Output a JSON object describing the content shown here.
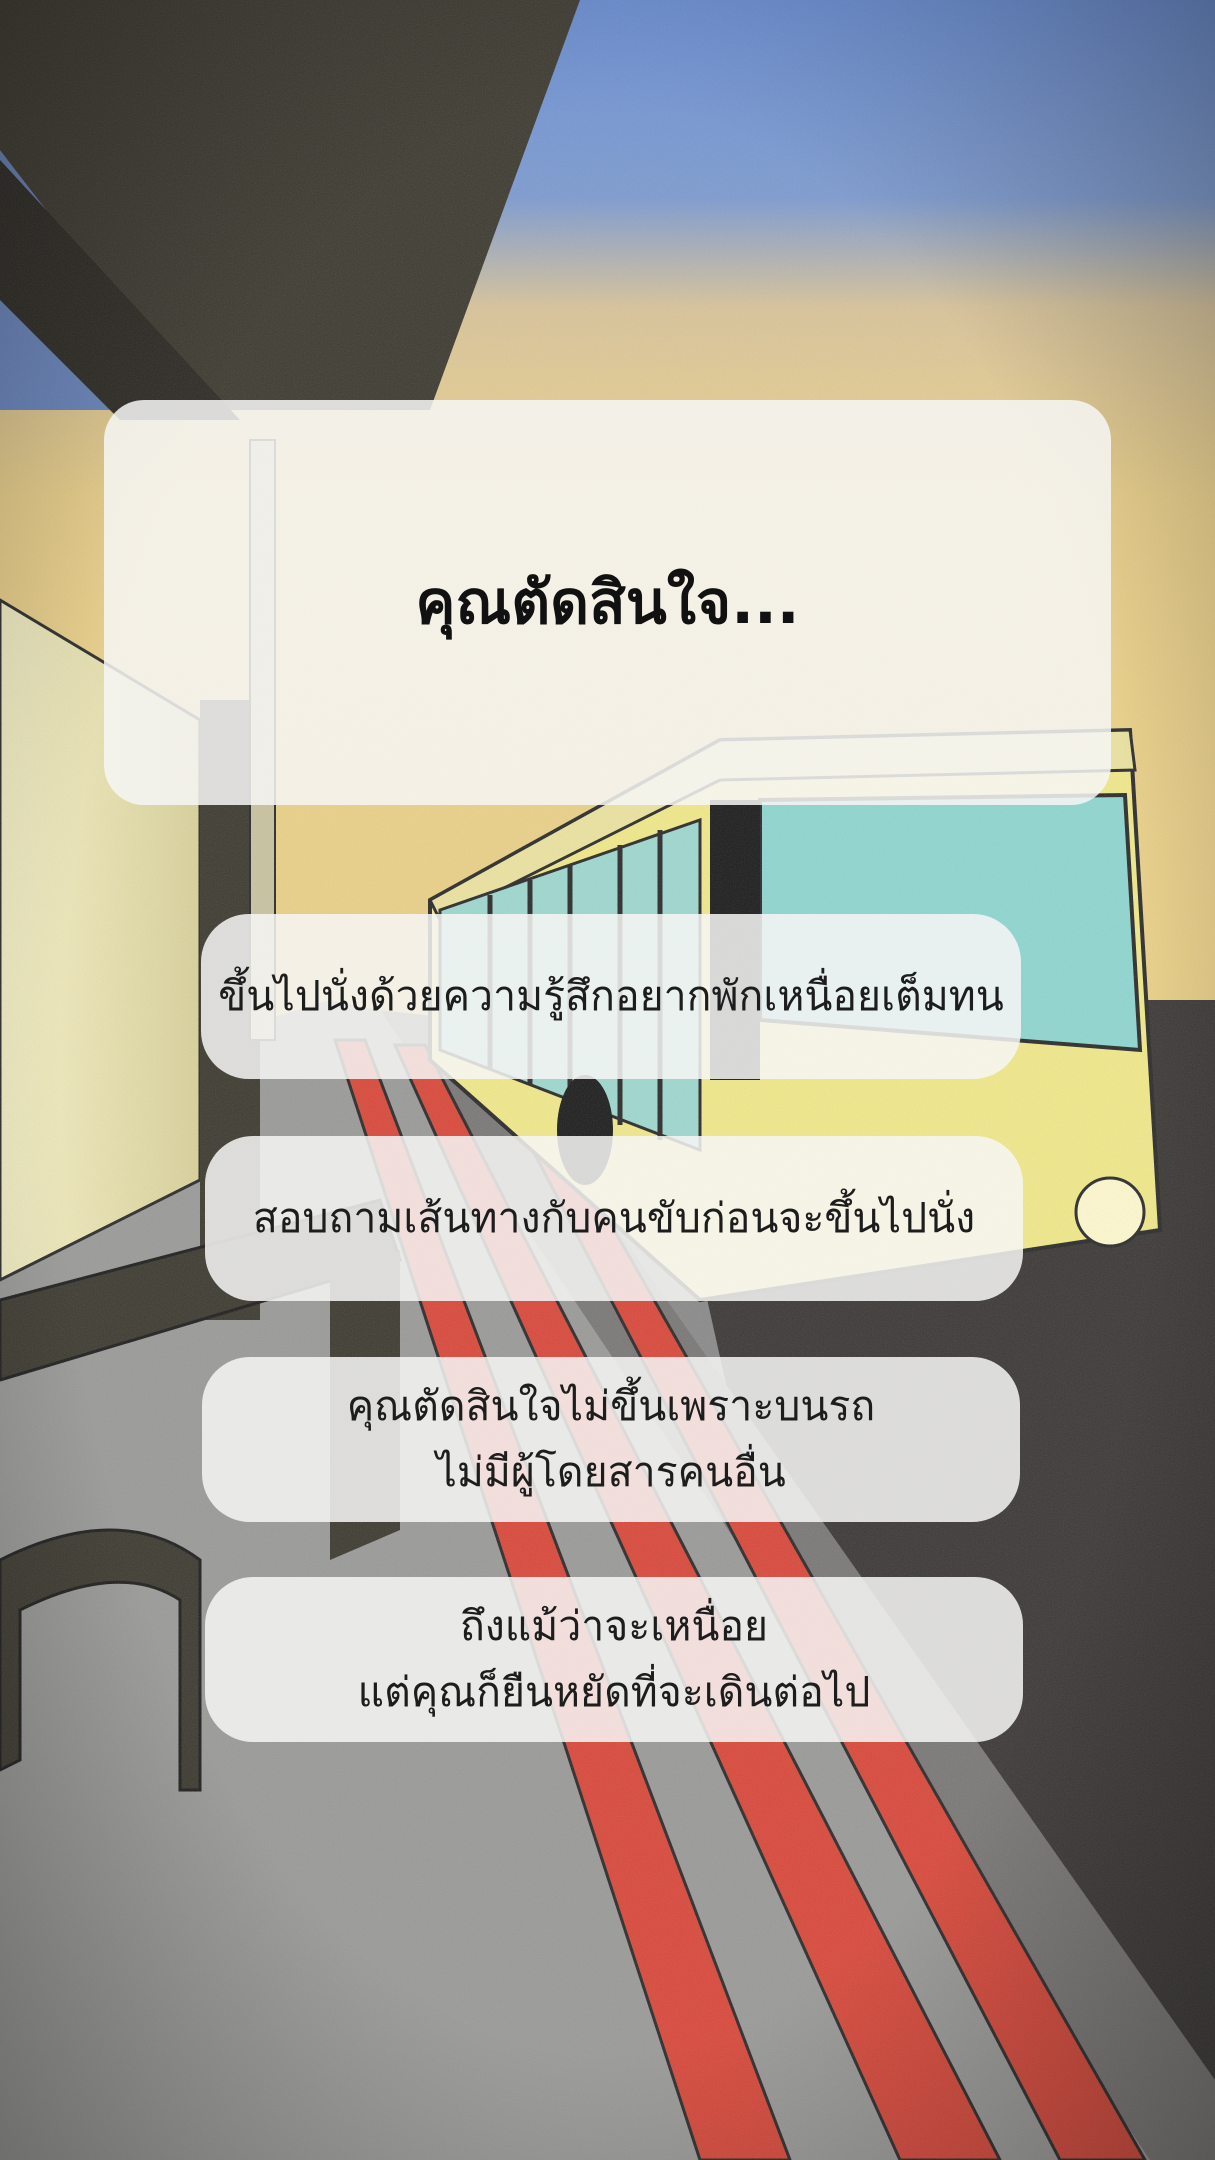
{
  "question": "คุณตัดสินใจ...",
  "choices": [
    {
      "lines": [
        "ขึ้นไปนั่งด้วยความรู้สึกอยากพักเหนื่อยเต็มทน"
      ]
    },
    {
      "lines": [
        "สอบถามเส้นทางกับคนขับก่อนจะขึ้นไปนั่ง"
      ]
    },
    {
      "lines": [
        "คุณตัดสินใจไม่ขึ้นเพราะบนรถ",
        "ไม่มีผู้โดยสารคนอื่น"
      ]
    },
    {
      "lines": [
        "ถึงแม้ว่าจะเหนื่อย",
        "แต่คุณก็ยืนหยัดที่จะเดินต่อไป"
      ]
    }
  ],
  "colors": {
    "sky": "#6f93d8",
    "sunset": "#e7cf86",
    "bus_body": "#f1e98a",
    "bus_window": "#8fd6d0",
    "road_line": "#d9483a",
    "asphalt": "#8c8c8c",
    "shelter": "#3d3a30"
  }
}
